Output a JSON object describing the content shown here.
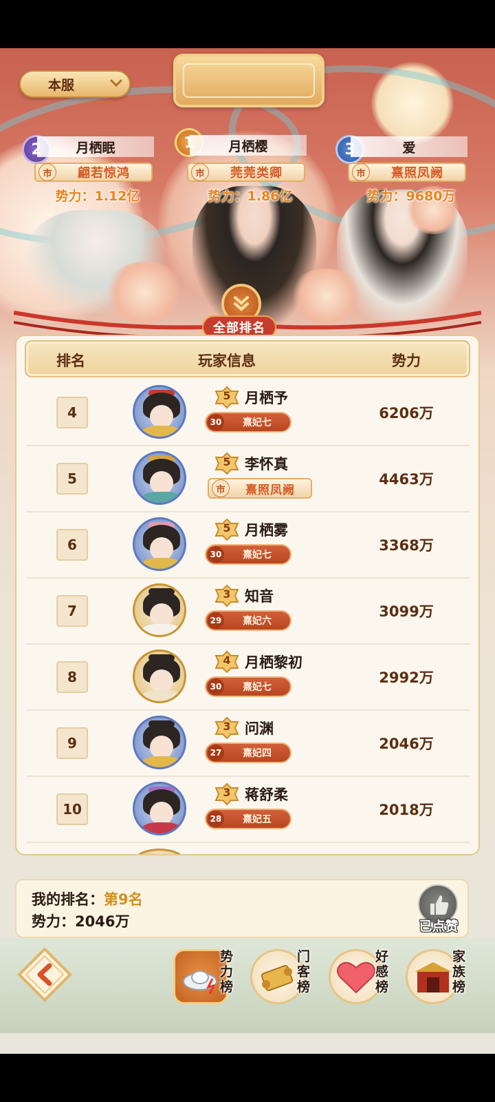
{
  "header": {
    "server_selector": "本服"
  },
  "top_three": [
    {
      "rank": "2",
      "name": "月栖眠",
      "title": "翩若惊鸿",
      "power": "势力：1.12亿"
    },
    {
      "rank": "1",
      "name": "月栖樱",
      "title": "莞莞类卿",
      "power": "势力：1.86亿"
    },
    {
      "rank": "3",
      "name": "爱",
      "title": "熹照凤阙",
      "power": "势力：9680万"
    }
  ],
  "title_market_mark": "市",
  "section_tab": "全部排名",
  "table": {
    "headers": {
      "rank": "排名",
      "info": "玩家信息",
      "power": "势力"
    },
    "rows": [
      {
        "rank": "4",
        "badge": "5",
        "name": "月栖予",
        "level": "30",
        "position": "熹妃七",
        "power": "6206万"
      },
      {
        "rank": "5",
        "badge": "5",
        "name": "李怀真",
        "title": "熹照凤阙",
        "power": "4463万"
      },
      {
        "rank": "6",
        "badge": "5",
        "name": "月栖雾",
        "level": "30",
        "position": "熹妃七",
        "power": "3368万"
      },
      {
        "rank": "7",
        "badge": "3",
        "name": "知音",
        "level": "29",
        "position": "熹妃六",
        "power": "3099万"
      },
      {
        "rank": "8",
        "badge": "4",
        "name": "月栖黎初",
        "level": "30",
        "position": "熹妃七",
        "power": "2992万"
      },
      {
        "rank": "9",
        "badge": "3",
        "name": "问渊",
        "level": "27",
        "position": "熹妃四",
        "power": "2046万"
      },
      {
        "rank": "10",
        "badge": "3",
        "name": "蒋舒柔",
        "level": "28",
        "position": "熹妃五",
        "power": "2018万"
      }
    ]
  },
  "my_rank": {
    "label": "我的排名：",
    "value": "第9名",
    "power_line": "势力：2046万",
    "like_status": "已点赞"
  },
  "nav": {
    "back_icon": "back-arrow-icon",
    "tabs": [
      {
        "label": "势力榜",
        "icon": "silver-ingot-icon",
        "active": true
      },
      {
        "label": "门客榜",
        "icon": "scroll-icon",
        "active": false
      },
      {
        "label": "好感榜",
        "icon": "heart-icon",
        "active": false
      },
      {
        "label": "家族榜",
        "icon": "palace-gate-icon",
        "active": false
      }
    ]
  },
  "colors": {
    "accent_orange": "#e8841c",
    "table_text": "#5c2e12",
    "pill_red": "#c4522a",
    "rank_gold": "#d2901d"
  }
}
